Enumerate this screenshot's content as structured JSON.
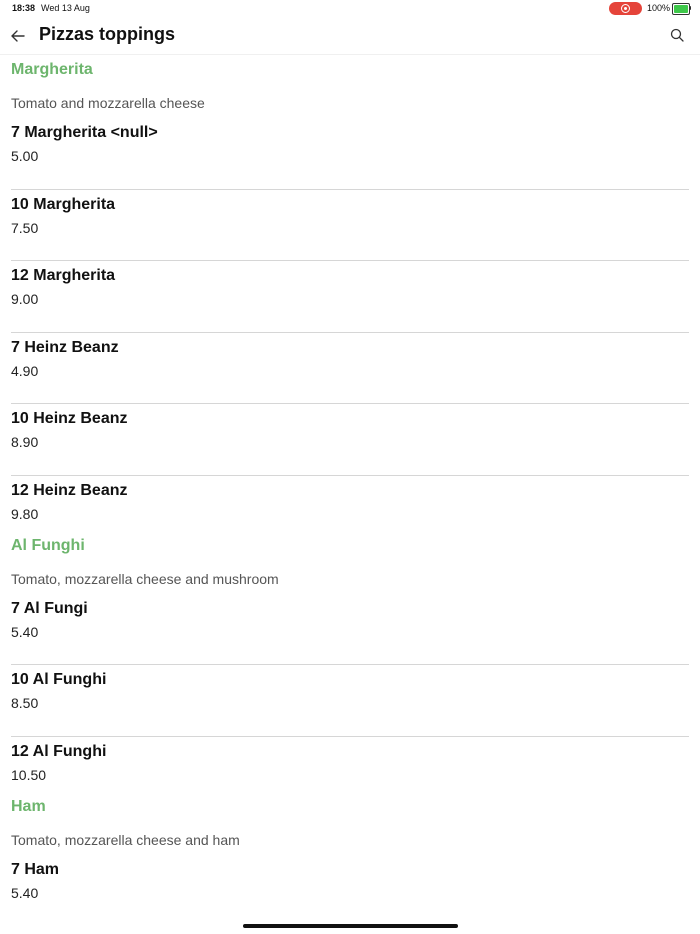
{
  "status_bar": {
    "time": "18:38",
    "date": "Wed 13 Aug",
    "battery": "100%",
    "recording_color": "#e5443a",
    "battery_color": "#3ec84a"
  },
  "header": {
    "title": "Pizzas toppings",
    "back_icon": "arrow-left-icon",
    "search_icon": "search-icon"
  },
  "colors": {
    "section_title": "#6db56d",
    "divider": "#d6d6d6"
  },
  "sections": [
    {
      "title": "Margherita",
      "description": "Tomato and mozzarella cheese",
      "items": [
        {
          "name": "7 Margherita <null>",
          "price": "5.00"
        },
        {
          "name": "10 Margherita",
          "price": "7.50"
        },
        {
          "name": "12 Margherita",
          "price": "9.00"
        },
        {
          "name": "7 Heinz Beanz",
          "price": "4.90"
        },
        {
          "name": "10 Heinz Beanz",
          "price": "8.90"
        },
        {
          "name": "12 Heinz Beanz",
          "price": "9.80"
        }
      ]
    },
    {
      "title": "Al Funghi",
      "description": "Tomato, mozzarella cheese and mushroom",
      "items": [
        {
          "name": "7 Al Fungi",
          "price": "5.40"
        },
        {
          "name": "10 Al Funghi",
          "price": "8.50"
        },
        {
          "name": "12 Al Funghi",
          "price": "10.50"
        }
      ]
    },
    {
      "title": "Ham",
      "description": "Tomato, mozzarella cheese and ham",
      "items": [
        {
          "name": "7 Ham",
          "price": "5.40"
        }
      ]
    }
  ]
}
